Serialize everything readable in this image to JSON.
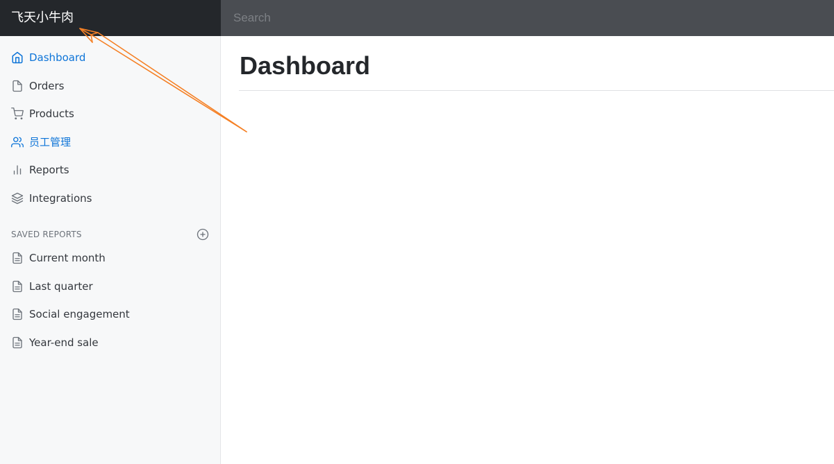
{
  "brand": {
    "title": "飞天小牛肉"
  },
  "search": {
    "placeholder": "Search"
  },
  "sidebar": {
    "items": [
      {
        "label": "Dashboard",
        "icon": "home-icon",
        "active": true
      },
      {
        "label": "Orders",
        "icon": "file-icon"
      },
      {
        "label": "Products",
        "icon": "cart-icon"
      },
      {
        "label": "员工管理",
        "icon": "users-icon",
        "active": true
      },
      {
        "label": "Reports",
        "icon": "bar-chart-icon"
      },
      {
        "label": "Integrations",
        "icon": "layers-icon"
      }
    ],
    "saved_reports": {
      "title": "SAVED REPORTS",
      "add_icon": "plus-circle-icon",
      "items": [
        {
          "label": "Current month",
          "icon": "file-text-icon"
        },
        {
          "label": "Last quarter",
          "icon": "file-text-icon"
        },
        {
          "label": "Social engagement",
          "icon": "file-text-icon"
        },
        {
          "label": "Year-end sale",
          "icon": "file-text-icon"
        }
      ]
    }
  },
  "main": {
    "title": "Dashboard"
  },
  "colors": {
    "brand_bg": "#24272b",
    "search_bg": "#4a4d52",
    "sidebar_bg": "#f7f8f9",
    "active": "#0d74d8",
    "annotation_arrow": "#f58025"
  }
}
